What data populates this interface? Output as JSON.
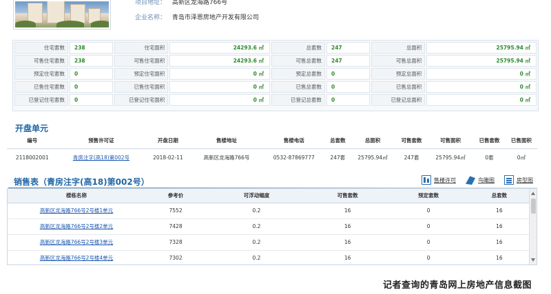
{
  "header": {
    "address_label": "项目地址：",
    "address_value": "高新区龙海路766号",
    "company_label": "企业名称：",
    "company_value": "青岛市泽恩房地产开发有限公司"
  },
  "stats": [
    [
      "住宅套数",
      "238",
      "住宅面积",
      "24293.6 ㎡",
      "总套数",
      "247",
      "总面积",
      "25795.94 ㎡"
    ],
    [
      "可售住宅套数",
      "238",
      "可售住宅面积",
      "24293.6 ㎡",
      "可售总套数",
      "247",
      "可售总面积",
      "25795.94 ㎡"
    ],
    [
      "预定住宅套数",
      "0",
      "预定住宅面积",
      "0 ㎡",
      "预定总套数",
      "0",
      "预定总面积",
      "0 ㎡"
    ],
    [
      "已售住宅套数",
      "0",
      "已售住宅面积",
      "0 ㎡",
      "已售总套数",
      "0",
      "已售总面积",
      "0 ㎡"
    ],
    [
      "已登记住宅套数",
      "0",
      "已登记住宅面积",
      "0 ㎡",
      "已登记总套数",
      "0",
      "已登记总面积",
      "0 ㎡"
    ]
  ],
  "open_unit": {
    "title": "开盘单元",
    "headers": [
      "编号",
      "预售许可证",
      "开盘日期",
      "售楼地址",
      "售楼电话",
      "总套数",
      "总面积",
      "可售套数",
      "可售面积",
      "已售套数",
      "已售面积"
    ],
    "row": [
      "2118002001",
      "青房注字(高18)第002号",
      "2018-02-11",
      "高新区龙海路766号",
      "0532-87869777",
      "247套",
      "25795.94㎡",
      "247套",
      "25795.94㎡",
      "0套",
      "0㎡"
    ]
  },
  "sales": {
    "title": "销售表（青房注字(高18)第002号）",
    "links": [
      "售楼许可",
      "鸟瞰图",
      "房型图"
    ],
    "headers": [
      "楼栋名称",
      "参考价",
      "可浮动幅度",
      "可售套数",
      "预定套数",
      "总套数"
    ],
    "rows": [
      [
        "高新区龙海路766号2号楼1单元",
        "7552",
        "0.2",
        "16",
        "0",
        "16"
      ],
      [
        "高新区龙海路766号2号楼2单元",
        "7428",
        "0.2",
        "16",
        "0",
        "16"
      ],
      [
        "高新区龙海路766号2号楼3单元",
        "7328",
        "0.2",
        "16",
        "0",
        "16"
      ],
      [
        "高新区龙海路766号2号楼4单元",
        "7302",
        "0.2",
        "16",
        "0",
        "16"
      ]
    ]
  },
  "caption": "记者查询的青岛网上房地产信息截图"
}
